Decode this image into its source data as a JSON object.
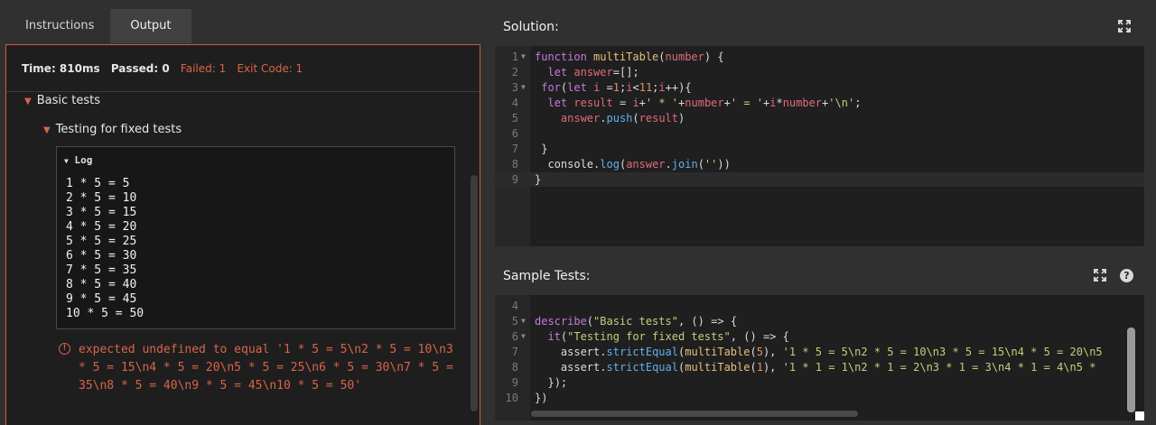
{
  "tabs": [
    "Instructions",
    "Output"
  ],
  "status": {
    "time": "Time: 810ms",
    "passed": "Passed: 0",
    "failed": "Failed: 1",
    "exit_code": "Exit Code: 1"
  },
  "tree": {
    "describe_label": "Basic tests",
    "it_label": "Testing for fixed tests",
    "log_title": "Log",
    "log_lines": [
      "1 * 5 = 5",
      "2 * 5 = 10",
      "3 * 5 = 15",
      "4 * 5 = 20",
      "5 * 5 = 25",
      "6 * 5 = 30",
      "7 * 5 = 35",
      "8 * 5 = 40",
      "9 * 5 = 45",
      "10 * 5 = 50"
    ],
    "error": "expected undefined to equal '1 * 5 = 5\\n2 * 5 = 10\\n3 * 5 = 15\\n4 * 5 = 20\\n5 * 5 = 25\\n6 * 5 = 30\\n7 * 5 = 35\\n8 * 5 = 40\\n9 * 5 = 45\\n10 * 5 = 50'"
  },
  "solution": {
    "title": "Solution:",
    "lines": [
      {
        "n": "1",
        "fold": true,
        "code": "function multiTable(number) {"
      },
      {
        "n": "2",
        "fold": false,
        "code": "  let answer=[];"
      },
      {
        "n": "3",
        "fold": true,
        "code": " for(let i =1;i<11;i++){"
      },
      {
        "n": "4",
        "fold": false,
        "code": "  let result = i+' * '+number+' = '+i*number+'\\n';"
      },
      {
        "n": "5",
        "fold": false,
        "code": "    answer.push(result)"
      },
      {
        "n": "6",
        "fold": false,
        "code": ""
      },
      {
        "n": "7",
        "fold": false,
        "code": " }"
      },
      {
        "n": "8",
        "fold": false,
        "code": "  console.log(answer.join(''))"
      },
      {
        "n": "9",
        "fold": false,
        "code": "}"
      }
    ]
  },
  "sample_tests": {
    "title": "Sample Tests:",
    "lines": [
      {
        "n": "4",
        "fold": false,
        "code": ""
      },
      {
        "n": "5",
        "fold": true,
        "code": "describe(\"Basic tests\", () => {"
      },
      {
        "n": "6",
        "fold": true,
        "code": "  it(\"Testing for fixed tests\", () => {"
      },
      {
        "n": "7",
        "fold": false,
        "code": "    assert.strictEqual(multiTable(5), '1 * 5 = 5\\n2 * 5 = 10\\n3 * 5 = 15\\n4 * 5 = 20\\n5"
      },
      {
        "n": "8",
        "fold": false,
        "code": "    assert.strictEqual(multiTable(1), '1 * 1 = 1\\n2 * 1 = 2\\n3 * 1 = 3\\n4 * 1 = 4\\n5 *"
      },
      {
        "n": "9",
        "fold": false,
        "code": "  });"
      },
      {
        "n": "10",
        "fold": false,
        "code": "})"
      }
    ]
  },
  "colors": {
    "accent_fail": "#d9644a",
    "keyword": "#c678dd",
    "function": "#e5c07b",
    "variable": "#e06c75",
    "string": "#c3d07a",
    "number": "#e0935c",
    "method": "#61afef"
  },
  "icons": {
    "expand": "expand-icon",
    "help": "help-icon",
    "caret": "caret-down-icon",
    "error": "error-icon"
  },
  "help_glyph": "?"
}
